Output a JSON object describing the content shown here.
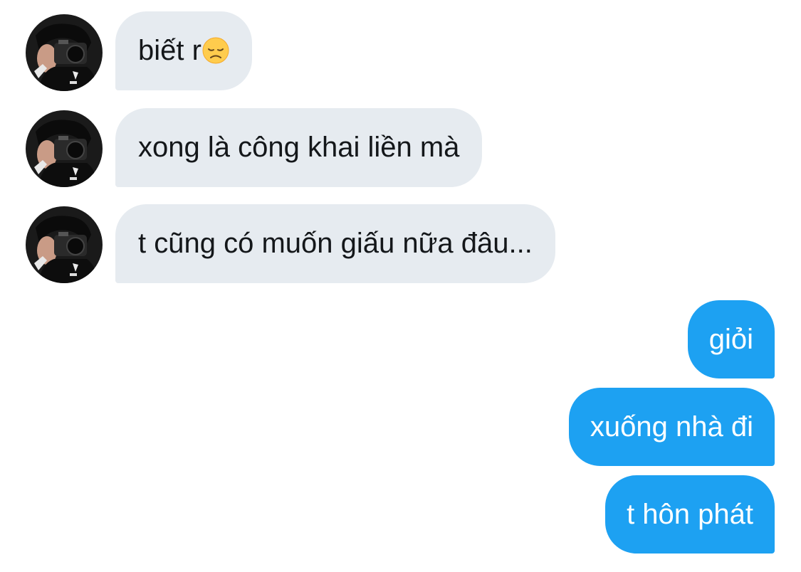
{
  "conversation": {
    "received": [
      {
        "text": "biết r",
        "emoji": "disappointed-face"
      },
      {
        "text": "xong là công khai liền mà"
      },
      {
        "text": "t cũng có muốn giấu nữa đâu..."
      }
    ],
    "sent": [
      {
        "text": "giỏi"
      },
      {
        "text": "xuống nhà đi"
      },
      {
        "text": "t hôn phát"
      }
    ]
  },
  "colors": {
    "received_bubble": "#e6ebf0",
    "received_text": "#14171a",
    "sent_bubble": "#1da1f2",
    "sent_text": "#ffffff"
  }
}
